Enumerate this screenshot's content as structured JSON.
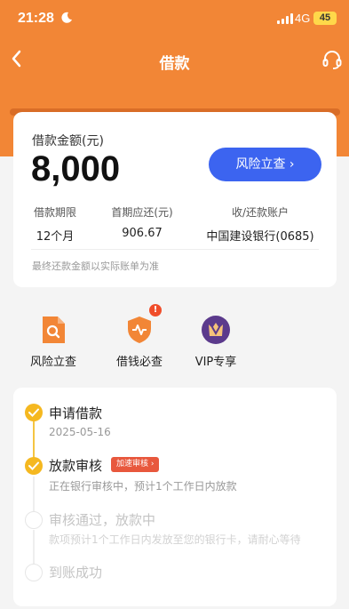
{
  "status_bar": {
    "time": "21:28",
    "network": "4G",
    "battery": "45"
  },
  "nav": {
    "title": "借款"
  },
  "loan": {
    "amount_label": "借款金额(元)",
    "amount": "8,000",
    "risk_button": "风险立查 ›",
    "term_label": "借款期限",
    "term_value": "12个月",
    "first_label": "首期应还(元)",
    "first_value": "906.67",
    "account_label": "收/还款账户",
    "account_value": "中国建设银行(0685)",
    "note": "最终还款金额以实际账单为准"
  },
  "quick": [
    {
      "label": "风险立查",
      "icon": "search-doc-icon"
    },
    {
      "label": "借钱必查",
      "icon": "shield-pulse-icon",
      "badge": "!"
    },
    {
      "label": "VIP专享",
      "icon": "vip-crown-icon"
    }
  ],
  "steps": [
    {
      "title": "申请借款",
      "sub": "2025-05-16",
      "status": "done"
    },
    {
      "title": "放款审核",
      "sub": "正在银行审核中，预计1个工作日内放款",
      "status": "done",
      "tag": "加速审核 ›"
    },
    {
      "title": "审核通过，放款中",
      "sub": "款项预计1个工作日内发放至您的银行卡，请耐心等待",
      "status": "todo"
    },
    {
      "title": "到账成功",
      "status": "todo"
    }
  ],
  "colors": {
    "brand_orange": "#f28636",
    "accent_blue": "#3c64f0",
    "step_done": "#f5b820",
    "tag_red": "#e8583d"
  }
}
